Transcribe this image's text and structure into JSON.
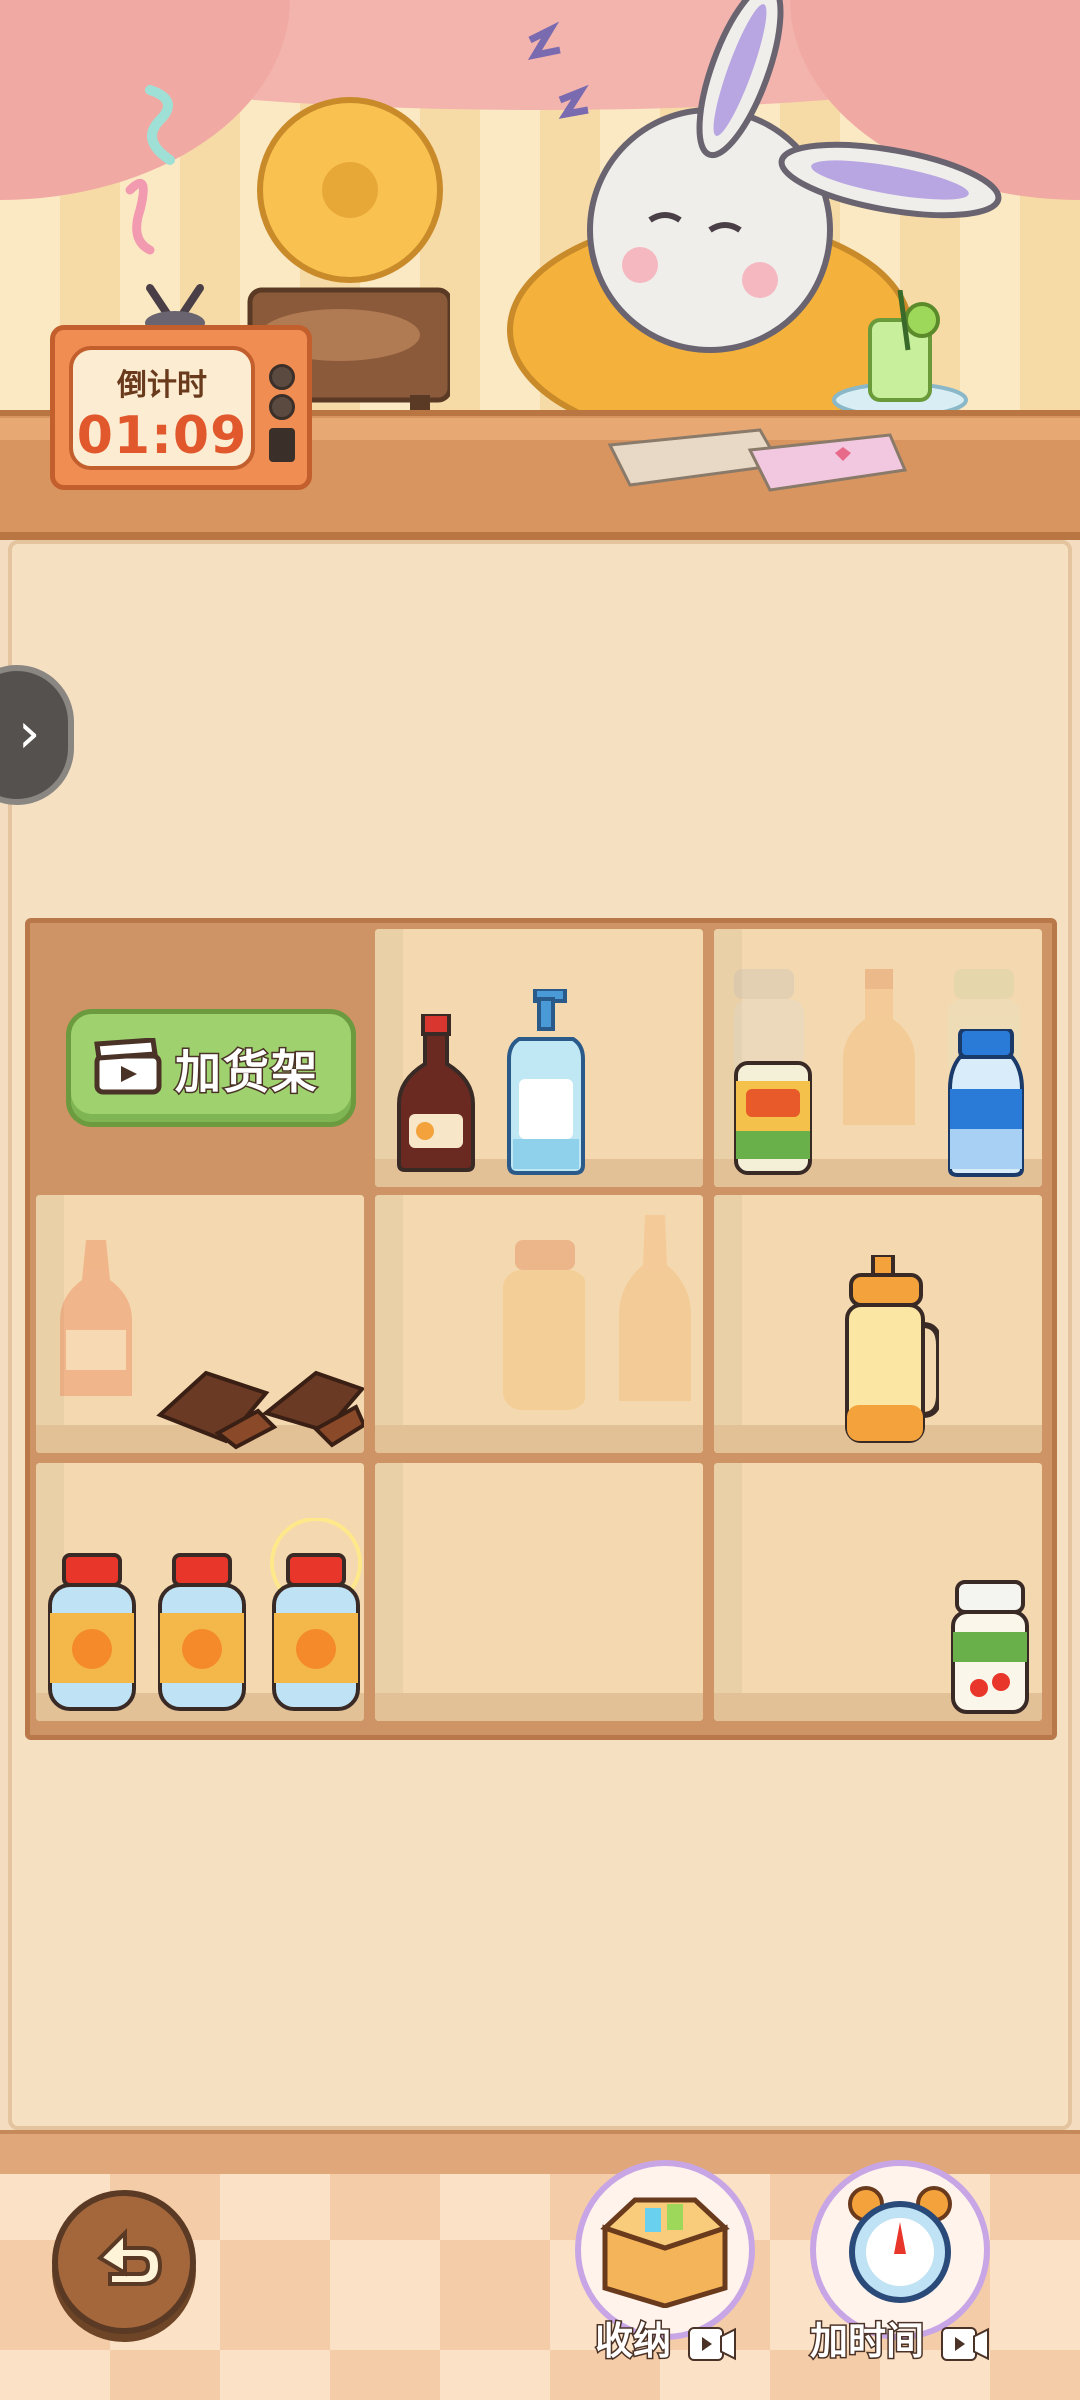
{
  "timer": {
    "label": "倒计时",
    "value": "01:09"
  },
  "shelf": {
    "add_shelf_label": "加货架"
  },
  "toolbar": {
    "storage_label": "收纳",
    "add_time_label": "加时间"
  },
  "colors": {
    "accent_green": "#9fd26f",
    "timer_orange": "#e0582c",
    "shelf_brown": "#cf9466"
  }
}
